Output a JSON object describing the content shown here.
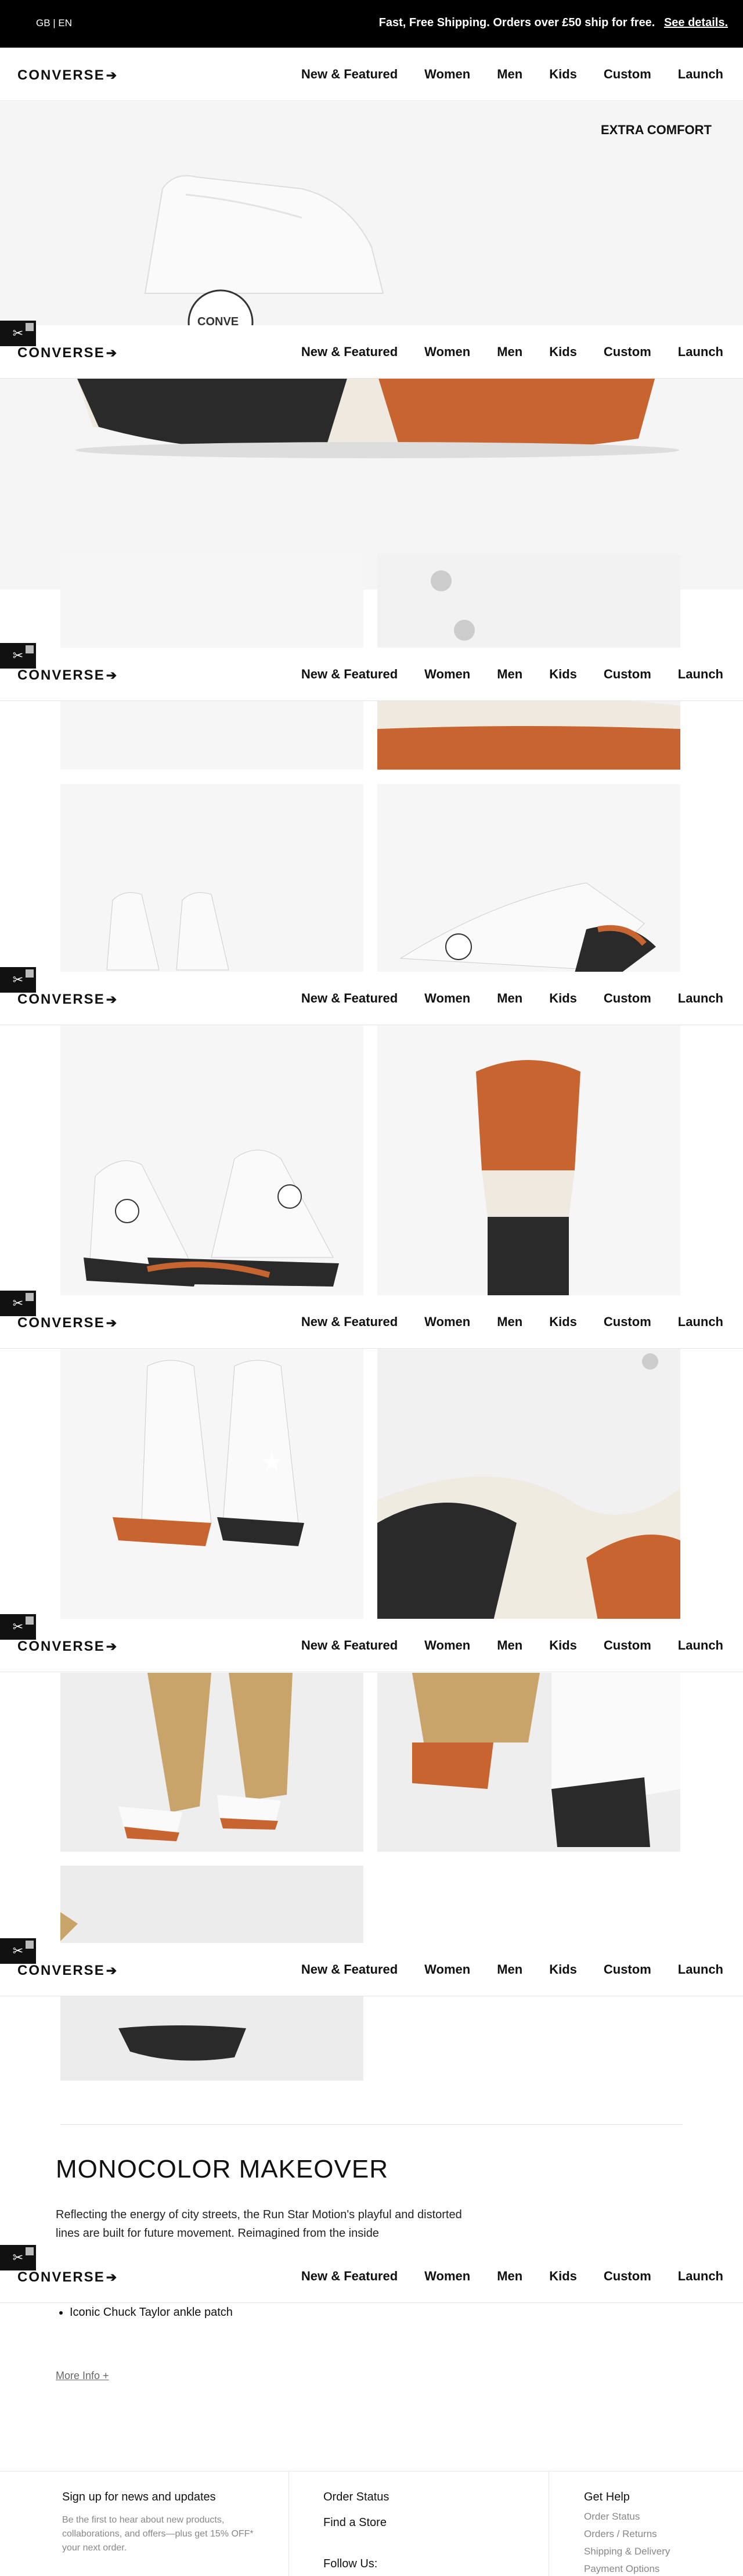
{
  "promo": {
    "locale": "GB | EN",
    "message": "Fast, Free Shipping. Orders over £50 ship for free.",
    "link": "See details."
  },
  "nav": {
    "logo": "CONVERSE",
    "items": [
      "New & Featured",
      "Women",
      "Men",
      "Kids",
      "Custom",
      "Launch"
    ]
  },
  "hero": {
    "kicker": "EXTRA COMFORT"
  },
  "story": {
    "title": "MONOCOLOR MAKEOVER",
    "body": "Reflecting the energy of city streets, the Run Star Motion's playful and distorted lines are built for future movement. Reimagined from the inside",
    "list": [
      "Iconic Chuck Taylor ankle patch"
    ],
    "more_info": "More Info +"
  },
  "footer": {
    "signup_title": "Sign up for news and updates",
    "signup_text": "Be the first to hear about new products, collaborations, and offers—plus get 15% OFF* your next order.",
    "order_status": "Order Status",
    "find_store": "Find a Store",
    "follow_us": "Follow Us:",
    "get_help": "Get Help",
    "help_links": [
      "Order Status",
      "Orders / Returns",
      "Shipping & Delivery",
      "Payment Options"
    ]
  },
  "colors": {
    "sole_black": "#2a2a2a",
    "sole_orange": "#c8642f",
    "sole_cream": "#efe9df",
    "upper_white": "#f4f4f2",
    "pants_tan": "#c8a36a"
  }
}
